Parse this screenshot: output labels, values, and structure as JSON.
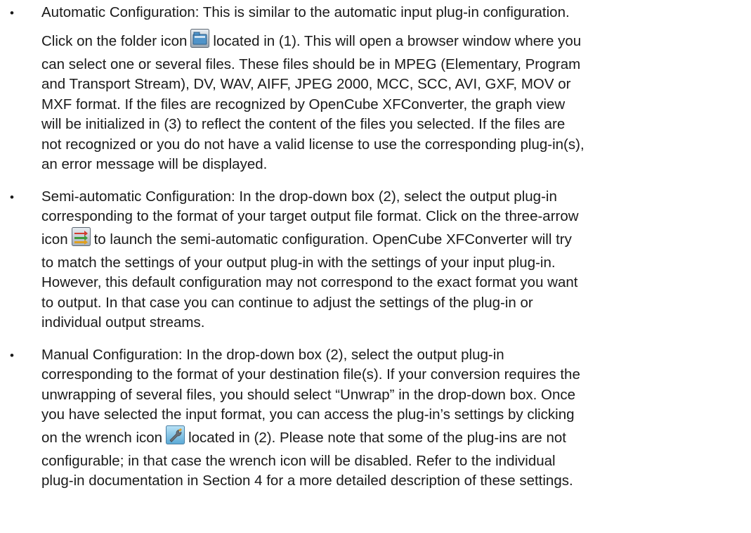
{
  "bullets": [
    {
      "symbol": "•",
      "first_line": "Automatic Configuration: This is similar to the automatic input plug-in configuration.",
      "para2": {
        "before_icon": "Click on the folder icon",
        "after_icon": "located in (1). This will open a browser window where you",
        "lines": [
          "can select one or several files. These files should be in MPEG (Elementary, Program",
          "and Transport Stream), DV, WAV, AIFF, JPEG 2000, MCC, SCC, AVI, GXF, MOV or",
          "MXF format. If the files are recognized by OpenCube XFConverter, the graph view",
          "will be initialized in (3) to reflect the content of the files you selected. If the files are",
          "not recognized or you do not have a valid license to use the corresponding plug-in(s),",
          "an error message will be displayed."
        ]
      },
      "icon": "folder-icon"
    },
    {
      "symbol": "•",
      "lines_before": [
        "Semi-automatic Configuration: In the drop-down box (2), select the output plug-in",
        "corresponding to the format of your target output file format. Click on the three-arrow"
      ],
      "icon_line": {
        "before_icon": "icon",
        "after_icon": "to launch the semi-automatic configuration. OpenCube XFConverter will try"
      },
      "lines_after": [
        "to match the settings of your output plug-in with the settings of your input plug-in.",
        "However, this default configuration may not correspond to the exact format you want",
        "to output. In that case you can continue to adjust the settings of the plug-in or",
        "individual output streams."
      ],
      "icon": "three-arrow-icon"
    },
    {
      "symbol": "•",
      "lines_before": [
        "Manual Configuration: In the drop-down box (2), select the output plug-in",
        "corresponding to the format of your destination file(s). If your conversion requires the",
        "unwrapping of several files, you should select “Unwrap” in the drop-down box. Once",
        "you have selected the input format, you can access the plug-in’s settings by clicking"
      ],
      "icon_line": {
        "before_icon": "on the wrench icon",
        "after_icon": "located in (2). Please note that some of the plug-ins are not"
      },
      "lines_after": [
        "configurable; in that case the wrench icon will be disabled. Refer to the individual",
        "plug-in documentation in Section 4 for a more detailed description of these settings."
      ],
      "icon": "wrench-icon"
    }
  ]
}
